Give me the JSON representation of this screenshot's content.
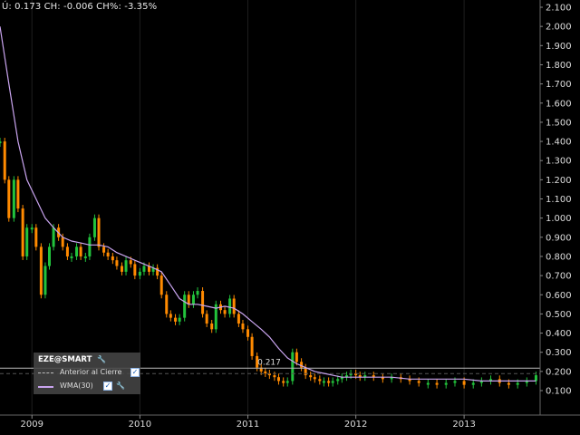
{
  "info": {
    "last_label": "Ú:",
    "last_value": "0.173",
    "change_label": "CH:",
    "change_value": "-0.006",
    "change_pct_label": "CH%:",
    "change_pct_value": "-3.35%"
  },
  "legend": {
    "symbol": "EZE@SMART",
    "series": [
      {
        "label": "Anterior al Cierre",
        "checked": true,
        "icon": "dashed-line-icon"
      },
      {
        "label": "WMA(30)",
        "checked": true,
        "icon": "purple-line-icon"
      }
    ],
    "wrench_icon": "wrench-icon"
  },
  "colors": {
    "background": "#000000",
    "up_candle": "#22c33c",
    "down_candle": "#ff8a00",
    "ma_line": "#c9a4ef",
    "prev_close_line": "#bbbbbb",
    "axis_text": "#dddddd"
  },
  "chart_data": {
    "type": "line",
    "y_axis": {
      "side": "right",
      "ticks": [
        "2.100",
        "2.000",
        "1.900",
        "1.800",
        "1.700",
        "1.600",
        "1.500",
        "1.400",
        "1.300",
        "1.200",
        "1.100",
        "1.000",
        "0.900",
        "0.800",
        "0.700",
        "0.600",
        "0.500",
        "0.400",
        "0.300",
        "0.200",
        "0.100"
      ],
      "range": [
        0.05,
        2.15
      ]
    },
    "x_axis": {
      "ticks": [
        "2009",
        "2010",
        "2011",
        "2012",
        "2013"
      ],
      "range": [
        "2008-09-15",
        "2013-09-15"
      ]
    },
    "reference_line": {
      "label": "0.217",
      "value": 0.217
    },
    "series": [
      {
        "name": "EZE@SMART",
        "x": [
          "2008-09-15",
          "2008-10-01",
          "2008-10-15",
          "2008-11-01",
          "2008-11-15",
          "2008-12-01",
          "2008-12-15",
          "2009-01-01",
          "2009-01-15",
          "2009-02-01",
          "2009-02-15",
          "2009-03-01",
          "2009-03-15",
          "2009-04-01",
          "2009-04-15",
          "2009-05-01",
          "2009-05-15",
          "2009-06-01",
          "2009-06-15",
          "2009-07-01",
          "2009-07-15",
          "2009-08-01",
          "2009-08-15",
          "2009-09-01",
          "2009-09-15",
          "2009-10-01",
          "2009-10-15",
          "2009-11-01",
          "2009-11-15",
          "2009-12-01",
          "2009-12-15",
          "2010-01-01",
          "2010-01-15",
          "2010-02-01",
          "2010-02-15",
          "2010-03-01",
          "2010-03-15",
          "2010-04-01",
          "2010-04-15",
          "2010-05-01",
          "2010-05-15",
          "2010-06-01",
          "2010-06-15",
          "2010-07-01",
          "2010-07-15",
          "2010-08-01",
          "2010-08-15",
          "2010-09-01",
          "2010-09-15",
          "2010-10-01",
          "2010-10-15",
          "2010-11-01",
          "2010-11-15",
          "2010-12-01",
          "2010-12-15",
          "2011-01-01",
          "2011-01-15",
          "2011-02-01",
          "2011-02-15",
          "2011-03-01",
          "2011-03-15",
          "2011-04-01",
          "2011-04-15",
          "2011-05-01",
          "2011-05-15",
          "2011-06-01",
          "2011-06-15",
          "2011-07-01",
          "2011-07-15",
          "2011-08-01",
          "2011-08-15",
          "2011-09-01",
          "2011-09-15",
          "2011-10-01",
          "2011-10-15",
          "2011-11-01",
          "2011-11-15",
          "2011-12-01",
          "2011-12-15",
          "2012-01-01",
          "2012-01-15",
          "2012-02-01",
          "2012-03-01",
          "2012-04-01",
          "2012-05-01",
          "2012-06-01",
          "2012-07-01",
          "2012-08-01",
          "2012-09-01",
          "2012-10-01",
          "2012-11-01",
          "2012-12-01",
          "2013-01-01",
          "2013-02-01",
          "2013-03-01",
          "2013-04-01",
          "2013-05-01",
          "2013-06-01",
          "2013-07-01",
          "2013-08-01",
          "2013-09-01"
        ],
        "values": [
          1.4,
          1.2,
          1.0,
          1.2,
          1.05,
          0.8,
          0.95,
          0.95,
          0.85,
          0.6,
          0.75,
          0.85,
          0.95,
          0.9,
          0.85,
          0.8,
          0.8,
          0.85,
          0.8,
          0.8,
          0.9,
          1.0,
          0.85,
          0.82,
          0.8,
          0.78,
          0.75,
          0.72,
          0.78,
          0.76,
          0.7,
          0.72,
          0.75,
          0.72,
          0.74,
          0.7,
          0.6,
          0.5,
          0.48,
          0.46,
          0.48,
          0.6,
          0.55,
          0.6,
          0.62,
          0.5,
          0.45,
          0.42,
          0.55,
          0.52,
          0.5,
          0.58,
          0.5,
          0.45,
          0.42,
          0.38,
          0.28,
          0.22,
          0.2,
          0.19,
          0.18,
          0.17,
          0.15,
          0.14,
          0.15,
          0.3,
          0.25,
          0.22,
          0.18,
          0.17,
          0.16,
          0.15,
          0.15,
          0.14,
          0.15,
          0.16,
          0.17,
          0.18,
          0.19,
          0.18,
          0.17,
          0.18,
          0.17,
          0.16,
          0.17,
          0.16,
          0.15,
          0.14,
          0.14,
          0.13,
          0.14,
          0.15,
          0.13,
          0.14,
          0.15,
          0.16,
          0.14,
          0.13,
          0.14,
          0.15,
          0.18
        ]
      },
      {
        "name": "WMA(30)",
        "x": [
          "2008-09-15",
          "2008-10-15",
          "2008-11-15",
          "2008-12-15",
          "2009-01-15",
          "2009-02-15",
          "2009-03-15",
          "2009-04-15",
          "2009-05-15",
          "2009-06-15",
          "2009-07-15",
          "2009-08-15",
          "2009-09-15",
          "2009-10-15",
          "2009-11-15",
          "2009-12-15",
          "2010-01-15",
          "2010-02-15",
          "2010-03-15",
          "2010-04-15",
          "2010-05-15",
          "2010-06-15",
          "2010-07-15",
          "2010-08-15",
          "2010-09-15",
          "2010-10-15",
          "2010-11-15",
          "2010-12-15",
          "2011-01-15",
          "2011-02-15",
          "2011-03-15",
          "2011-04-15",
          "2011-05-15",
          "2011-06-15",
          "2011-07-15",
          "2011-08-15",
          "2011-09-15",
          "2011-10-15",
          "2011-11-15",
          "2011-12-15",
          "2012-01-15",
          "2012-03-01",
          "2012-05-01",
          "2012-07-01",
          "2012-09-01",
          "2012-11-01",
          "2013-01-01",
          "2013-03-01",
          "2013-05-01",
          "2013-07-01",
          "2013-09-01"
        ],
        "values": [
          2.0,
          1.7,
          1.4,
          1.2,
          1.1,
          1.0,
          0.95,
          0.9,
          0.88,
          0.87,
          0.86,
          0.86,
          0.85,
          0.82,
          0.8,
          0.78,
          0.76,
          0.74,
          0.72,
          0.65,
          0.58,
          0.55,
          0.55,
          0.54,
          0.53,
          0.54,
          0.53,
          0.5,
          0.46,
          0.42,
          0.38,
          0.32,
          0.27,
          0.24,
          0.22,
          0.2,
          0.19,
          0.18,
          0.17,
          0.17,
          0.17,
          0.17,
          0.17,
          0.16,
          0.16,
          0.16,
          0.16,
          0.15,
          0.15,
          0.15,
          0.15
        ]
      }
    ]
  }
}
